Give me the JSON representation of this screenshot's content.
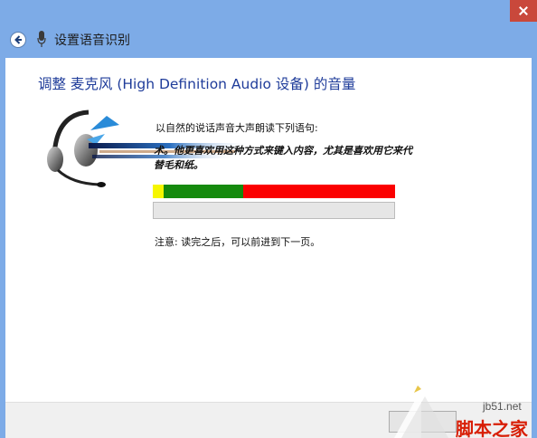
{
  "window": {
    "title": "设置语音识别"
  },
  "page": {
    "heading": "调整 麦克风 (High Definition Audio 设备) 的音量",
    "instruction": "以自然的说话声音大声朗读下列语句:",
    "read_text_line1": "术。他更喜欢用这种方式来键入内容，尤其是喜欢用它来代",
    "read_text_line2": "替毛和纸。",
    "note": "注意: 读完之后，可以前进到下一页。"
  },
  "meter": {
    "colors": {
      "yellow": "#f6f600",
      "green": "#158a0d",
      "red": "#fb0000"
    }
  },
  "progress": {
    "value_fraction": 0
  },
  "footer": {
    "next_label": ""
  },
  "watermark": {
    "url": "jb51.net",
    "brand": "脚本之家"
  },
  "icons": {
    "back": "back-arrow-icon",
    "mic": "microphone-icon",
    "close": "close-icon",
    "headset": "headset-icon"
  },
  "colors": {
    "titlebar": "#7dabe7",
    "heading": "#1f3c9a",
    "close": "#c9483b"
  }
}
